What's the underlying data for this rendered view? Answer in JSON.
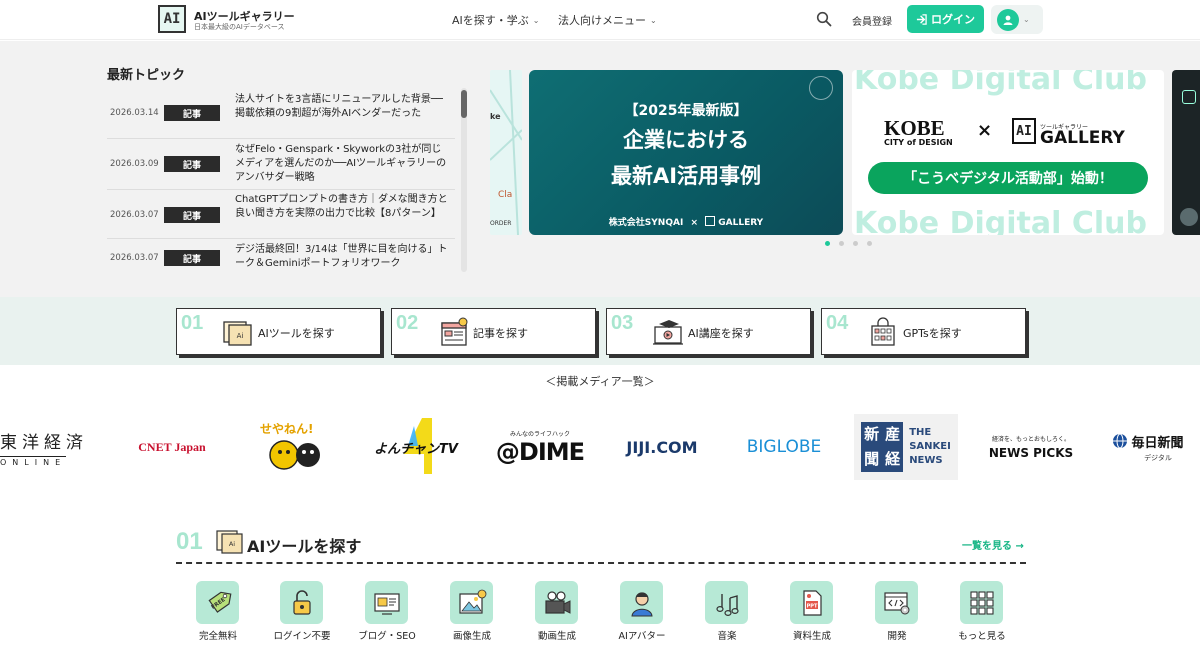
{
  "header": {
    "logo_mark": "AI",
    "site_title": "AIツールギャラリー",
    "site_subtitle": "日本最大級のAIデータベース",
    "nav": [
      {
        "label": "AIを探す・学ぶ"
      },
      {
        "label": "法人向けメニュー"
      }
    ],
    "member_register": "会員登録",
    "login_label": "ログイン",
    "icons": {
      "search": "search-icon",
      "login": "login-icon",
      "user": "user-icon"
    },
    "colors": {
      "accent": "#1ec99a"
    }
  },
  "topics": {
    "title": "最新トピック",
    "items": [
      {
        "date": "2026.03.14",
        "badge": "記事",
        "text": "法人サイトを3言語にリニューアルした背景──掲載依頼の9割超が海外AIベンダーだった"
      },
      {
        "date": "2026.03.09",
        "badge": "記事",
        "text": "なぜFelo・Genspark・Skyworkの3社が同じメディアを選んだのか──AIツールギャラリーのアンバサダー戦略"
      },
      {
        "date": "2026.03.07",
        "badge": "記事",
        "text": "ChatGPTプロンプトの書き方｜ダメな聞き方と良い聞き方を実際の出力で比較【8パターン】"
      },
      {
        "date": "2026.03.07",
        "badge": "記事",
        "text": "デジ活最終回！3/14は「世界に目を向ける」トーク＆Geminiポートフォリオワーク"
      }
    ]
  },
  "carousel": {
    "main": {
      "line1": "【2025年最新版】",
      "line2": "企業における",
      "line3": "最新AI活用事例",
      "footer_left": "株式会社SYNQAI",
      "footer_x": "×",
      "footer_right": "GALLERY"
    },
    "second": {
      "bg_text": "Kobe Digital Club",
      "kobe": "KOBE",
      "kobe_sub": "CITY of DESIGN",
      "cross": "×",
      "gallery_mark": "AI",
      "gallery_small": "ツールギャラリー",
      "gallery_word": "GALLERY",
      "pill": "「こうべデジタル活動部」始動！"
    },
    "left_peek": {
      "t1": "ke",
      "t2": "Cla",
      "t3": "ORDER"
    },
    "dots": 4,
    "active_dot": 0
  },
  "quick_nav": [
    {
      "num": "01",
      "label": "AIツールを探す",
      "icon": "folder-icon"
    },
    {
      "num": "02",
      "label": "記事を探す",
      "icon": "article-icon"
    },
    {
      "num": "03",
      "label": "AI講座を探す",
      "icon": "course-icon"
    },
    {
      "num": "04",
      "label": "GPTsを探す",
      "icon": "gpts-icon"
    }
  ],
  "media": {
    "title": "＜掲載メディア一覧＞",
    "logos": {
      "toyo_top": "東洋経済",
      "toyo_bottom": "ONLINE",
      "cnet": "CNET Japan",
      "seyanen": "せやねん!",
      "yon": "よんチャンTV",
      "dime_top": "みんなのライフハック",
      "dime": "@DIME",
      "jiji": "JIJI.COM",
      "biglobe": "BIGLOBE",
      "sankei_k1": "産",
      "sankei_k2": "経",
      "sankei_k3": "新",
      "sankei_k4": "聞",
      "sankei_en1": "THE",
      "sankei_en2": "SANKEI",
      "sankei_en3": "NEWS",
      "newspicks_top": "経済を、もっとおもしろく。",
      "newspicks": "NEWS PICKS",
      "mainichi": "毎日新聞",
      "mainichi_sub": "デジタル"
    }
  },
  "tools_section": {
    "num": "01",
    "title": "AIツールを探す",
    "more": "一覧を見る →",
    "categories": [
      {
        "label": "完全無料",
        "icon": "free-tag-icon"
      },
      {
        "label": "ログイン不要",
        "icon": "unlock-icon"
      },
      {
        "label": "ブログ・SEO",
        "icon": "blog-icon"
      },
      {
        "label": "画像生成",
        "icon": "image-icon"
      },
      {
        "label": "動画生成",
        "icon": "video-camera-icon"
      },
      {
        "label": "AIアバター",
        "icon": "avatar-icon"
      },
      {
        "label": "音楽",
        "icon": "music-icon"
      },
      {
        "label": "資料生成",
        "icon": "document-icon"
      },
      {
        "label": "開発",
        "icon": "code-icon"
      },
      {
        "label": "もっと見る",
        "icon": "grid-icon"
      }
    ]
  }
}
